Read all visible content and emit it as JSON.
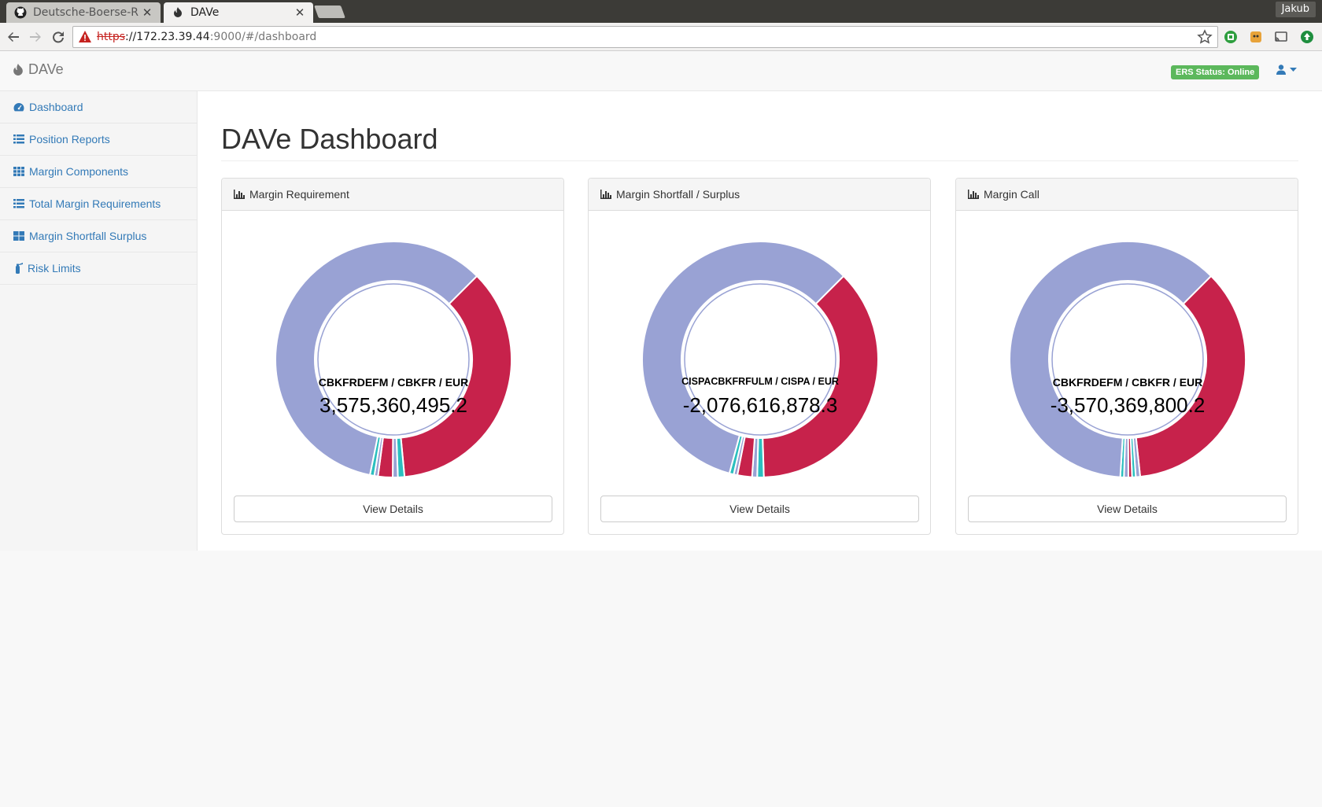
{
  "browser": {
    "tabs": [
      {
        "title": "Deutsche-Boerse-R",
        "active": false
      },
      {
        "title": "DAVe",
        "active": true
      }
    ],
    "profile_name": "Jakub",
    "url": {
      "scheme": "https",
      "host": "://172.23.39.44",
      "path": ":9000/#/dashboard"
    }
  },
  "navbar": {
    "brand": "DAVe",
    "ers_status": "ERS Status: Online"
  },
  "sidebar": {
    "items": [
      {
        "label": "Dashboard",
        "icon": "dashboard-icon"
      },
      {
        "label": "Position Reports",
        "icon": "list-icon"
      },
      {
        "label": "Margin Components",
        "icon": "grid-icon"
      },
      {
        "label": "Total Margin Requirements",
        "icon": "list-icon"
      },
      {
        "label": "Margin Shortfall Surplus",
        "icon": "grid-icon"
      },
      {
        "label": "Risk Limits",
        "icon": "fire-extinguisher-icon"
      }
    ]
  },
  "main": {
    "title": "DAVe Dashboard",
    "view_details_label": "View Details",
    "panels": [
      {
        "title": "Margin Requirement",
        "account": "CBKFRDEFM / CBKFR / EUR",
        "value": "3,575,360,495.2"
      },
      {
        "title": "Margin Shortfall / Surplus",
        "account": "CISPACBKFRFULM / CISPA / EUR",
        "value": "-2,076,616,878.3"
      },
      {
        "title": "Margin Call",
        "account": "CBKFRDEFM / CBKFR / EUR",
        "value": "-3,570,369,800.2"
      }
    ]
  },
  "colors": {
    "slate": "#99a2d4",
    "crimson": "#c7224b",
    "teal": "#2bbfbf",
    "link": "#337ab7",
    "badge": "#5cb85c"
  },
  "chart_data": [
    {
      "type": "pie",
      "title": "Margin Requirement",
      "slices": [
        {
          "color": "#c7224b",
          "value": 36.0
        },
        {
          "color": "#2bbfbf",
          "value": 0.9
        },
        {
          "color": "#99a2d4",
          "value": 0.7
        },
        {
          "color": "#c7224b",
          "value": 2.0
        },
        {
          "color": "#99a2d4",
          "value": 0.5
        },
        {
          "color": "#2bbfbf",
          "value": 0.6
        },
        {
          "color": "#99a2d4",
          "value": 59.3
        }
      ],
      "center": {
        "label": "CBKFRDEFM / CBKFR / EUR",
        "value": "3,575,360,495.2"
      }
    },
    {
      "type": "pie",
      "title": "Margin Shortfall / Surplus",
      "slices": [
        {
          "color": "#c7224b",
          "value": 37.0
        },
        {
          "color": "#2bbfbf",
          "value": 0.9
        },
        {
          "color": "#99a2d4",
          "value": 0.7
        },
        {
          "color": "#c7224b",
          "value": 2.0
        },
        {
          "color": "#99a2d4",
          "value": 0.5
        },
        {
          "color": "#2bbfbf",
          "value": 0.6
        },
        {
          "color": "#99a2d4",
          "value": 58.3
        }
      ],
      "center": {
        "label": "CISPACBKFRFULM / CISPA / EUR",
        "value": "-2,076,616,878.3"
      }
    },
    {
      "type": "pie",
      "title": "Margin Call",
      "slices": [
        {
          "color": "#c7224b",
          "value": 35.8
        },
        {
          "color": "#99a2d4",
          "value": 0.6
        },
        {
          "color": "#2bbfbf",
          "value": 0.5
        },
        {
          "color": "#c7224b",
          "value": 0.5
        },
        {
          "color": "#99a2d4",
          "value": 0.6
        },
        {
          "color": "#2bbfbf",
          "value": 0.5
        },
        {
          "color": "#99a2d4",
          "value": 61.5
        }
      ],
      "center": {
        "label": "CBKFRDEFM / CBKFR / EUR",
        "value": "-3,570,369,800.2"
      }
    }
  ]
}
